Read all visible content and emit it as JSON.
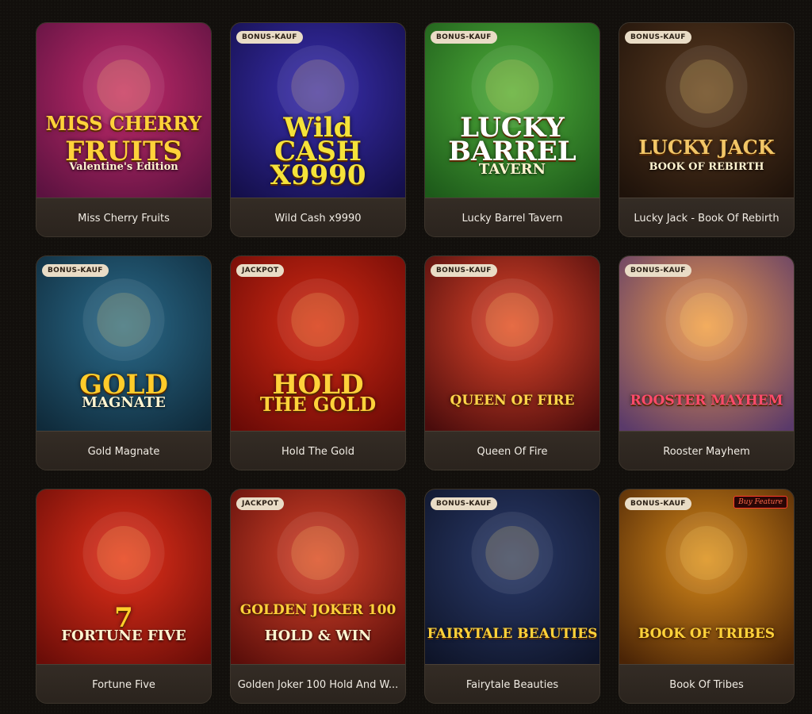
{
  "games": [
    {
      "title": "Miss Cherry Fruits",
      "badge": "",
      "logo_lines": [
        "MISS CHERRY",
        "FRUITS"
      ],
      "logo_sub": "Valentine's Edition",
      "bg1": "#c22a6a",
      "bg2": "#5b1240",
      "logo_color": "#ffd23a",
      "icon": "woman-cherry-art"
    },
    {
      "title": "Wild Cash x9990",
      "badge": "BONUS-KAUF",
      "logo_lines": [
        "Wild",
        "CASH",
        "X9990"
      ],
      "logo_sub": "",
      "bg1": "#3a2fb0",
      "bg2": "#140f4a",
      "logo_color": "#f5e33a",
      "icon": "wild-cash-logo-art"
    },
    {
      "title": "Lucky Barrel Tavern",
      "badge": "BONUS-KAUF",
      "logo_lines": [
        "LUCKY",
        "BARREL"
      ],
      "logo_sub": "TAVERN",
      "bg1": "#4fae3a",
      "bg2": "#1d5a1a",
      "logo_color": "#ffffff",
      "icon": "leprechaun-art"
    },
    {
      "title": "Lucky Jack - Book Of Rebirth",
      "badge": "BONUS-KAUF",
      "logo_lines": [
        "LUCKY JACK"
      ],
      "logo_sub": "BOOK OF REBIRTH",
      "bg1": "#5a3a20",
      "bg2": "#1e120a",
      "logo_color": "#f1c667",
      "icon": "golden-book-art"
    },
    {
      "title": "Gold Magnate",
      "badge": "BONUS-KAUF",
      "logo_lines": [
        "GOLD"
      ],
      "logo_sub": "MAGNATE",
      "bg1": "#2a6a8a",
      "bg2": "#0f2a3a",
      "logo_color": "#ffcc2a",
      "icon": "magnate-man-art"
    },
    {
      "title": "Hold The Gold",
      "badge": "JACKPOT",
      "logo_lines": [
        "HOLD",
        "THE GOLD"
      ],
      "logo_sub": "",
      "bg1": "#d42a14",
      "bg2": "#6a0a06",
      "logo_color": "#ffd23a",
      "icon": "gold-coin-art"
    },
    {
      "title": "Queen Of Fire",
      "badge": "BONUS-KAUF",
      "logo_lines": [
        "QUEEN OF FIRE"
      ],
      "logo_sub": "",
      "bg1": "#e0452a",
      "bg2": "#4a0c0c",
      "logo_color": "#ffd54a",
      "icon": "fire-queen-art"
    },
    {
      "title": "Rooster Mayhem",
      "badge": "BONUS-KAUF",
      "logo_lines": [
        "ROOSTER MAYHEM"
      ],
      "logo_sub": "",
      "bg1": "#f09a4a",
      "bg2": "#5a3a6a",
      "logo_color": "#ff4a6a",
      "icon": "rooster-art"
    },
    {
      "title": "Fortune Five",
      "badge": "",
      "logo_lines": [
        "7"
      ],
      "logo_sub": "FORTUNE FIVE",
      "bg1": "#e4301a",
      "bg2": "#6a0d08",
      "logo_color": "#ffcf2a",
      "icon": "lucky-seven-art"
    },
    {
      "title": "Golden Joker 100 Hold And W...",
      "badge": "JACKPOT",
      "logo_lines": [
        "GOLDEN JOKER 100"
      ],
      "logo_sub": "HOLD & WIN",
      "bg1": "#d8432a",
      "bg2": "#5a0e0a",
      "logo_color": "#ffd23a",
      "icon": "joker-art"
    },
    {
      "title": "Fairytale Beauties",
      "badge": "BONUS-KAUF",
      "logo_lines": [
        "FAIRYTALE BEAUTIES"
      ],
      "logo_sub": "",
      "bg1": "#2a3a6a",
      "bg2": "#0e1428",
      "logo_color": "#ffd23a",
      "icon": "fairytale-art"
    },
    {
      "title": "Book Of Tribes",
      "badge": "BONUS-KAUF",
      "logo_lines": [
        "BOOK OF TRIBES"
      ],
      "logo_sub": "",
      "bg1": "#d88a1a",
      "bg2": "#4a2406",
      "logo_color": "#ffd23a",
      "icon": "tribe-book-art",
      "extra_tag": "Buy Feature"
    }
  ]
}
